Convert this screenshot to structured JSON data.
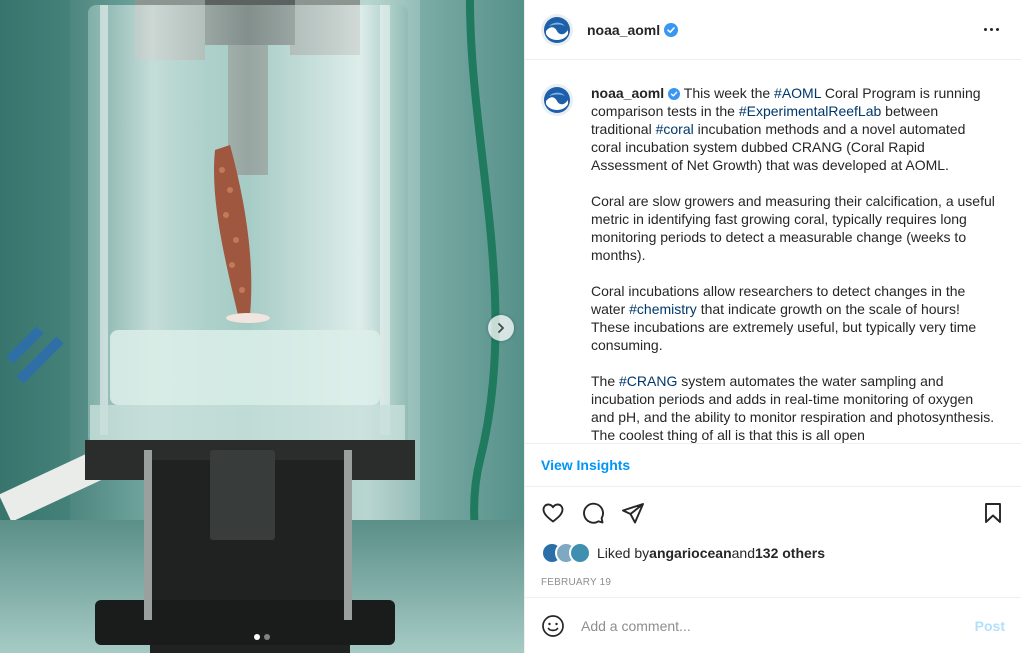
{
  "header": {
    "username": "noaa_aoml"
  },
  "caption": {
    "username": "noaa_aoml",
    "p1": [
      {
        "t": "This week the ",
        "tag": false
      },
      {
        "t": "#AOML",
        "tag": true
      },
      {
        "t": " Coral Program is running comparison tests in the ",
        "tag": false
      },
      {
        "t": "#ExperimentalReefLab",
        "tag": true
      },
      {
        "t": " between traditional ",
        "tag": false
      },
      {
        "t": "#coral",
        "tag": true
      },
      {
        "t": " incubation methods and a novel automated coral incubation system dubbed CRANG (Coral Rapid Assessment of Net Growth) that was developed at AOML.",
        "tag": false
      }
    ],
    "p2": "Coral are slow growers and measuring their calcification, a useful metric in identifying fast growing coral, typically requires long monitoring periods to detect a measurable change (weeks to months).",
    "p3": [
      {
        "t": "Coral incubations allow researchers to detect changes in the water ",
        "tag": false
      },
      {
        "t": "#chemistry",
        "tag": true
      },
      {
        "t": " that indicate growth on the scale of hours! These incubations are extremely useful, but typically very time consuming.",
        "tag": false
      }
    ],
    "p4": [
      {
        "t": "The ",
        "tag": false
      },
      {
        "t": "#CRANG",
        "tag": true
      },
      {
        "t": " system automates the water sampling and incubation periods and adds in real-time monitoring of oxygen and pH, and the ability to monitor respiration and photosynthesis. The coolest thing of all is that this is all open",
        "tag": false
      }
    ]
  },
  "insights": {
    "label": "View Insights"
  },
  "likes": {
    "prefix": "Liked by ",
    "user": "angariocean",
    "middle": " and ",
    "others": "132 others"
  },
  "date": "February 19",
  "comment": {
    "placeholder": "Add a comment...",
    "post_label": "Post"
  },
  "carousel": {
    "slide_count": 2,
    "active_index": 0
  },
  "colors": {
    "accent": "#0095f6",
    "hashtag": "#00376b",
    "post_disabled": "#b2dffc",
    "verified": "#3897f0"
  },
  "icons": [
    "noaa-logo-icon",
    "verified-badge-icon",
    "more-options-icon",
    "heart-icon",
    "comment-icon",
    "share-icon",
    "bookmark-icon",
    "emoji-icon",
    "chevron-right-icon"
  ]
}
